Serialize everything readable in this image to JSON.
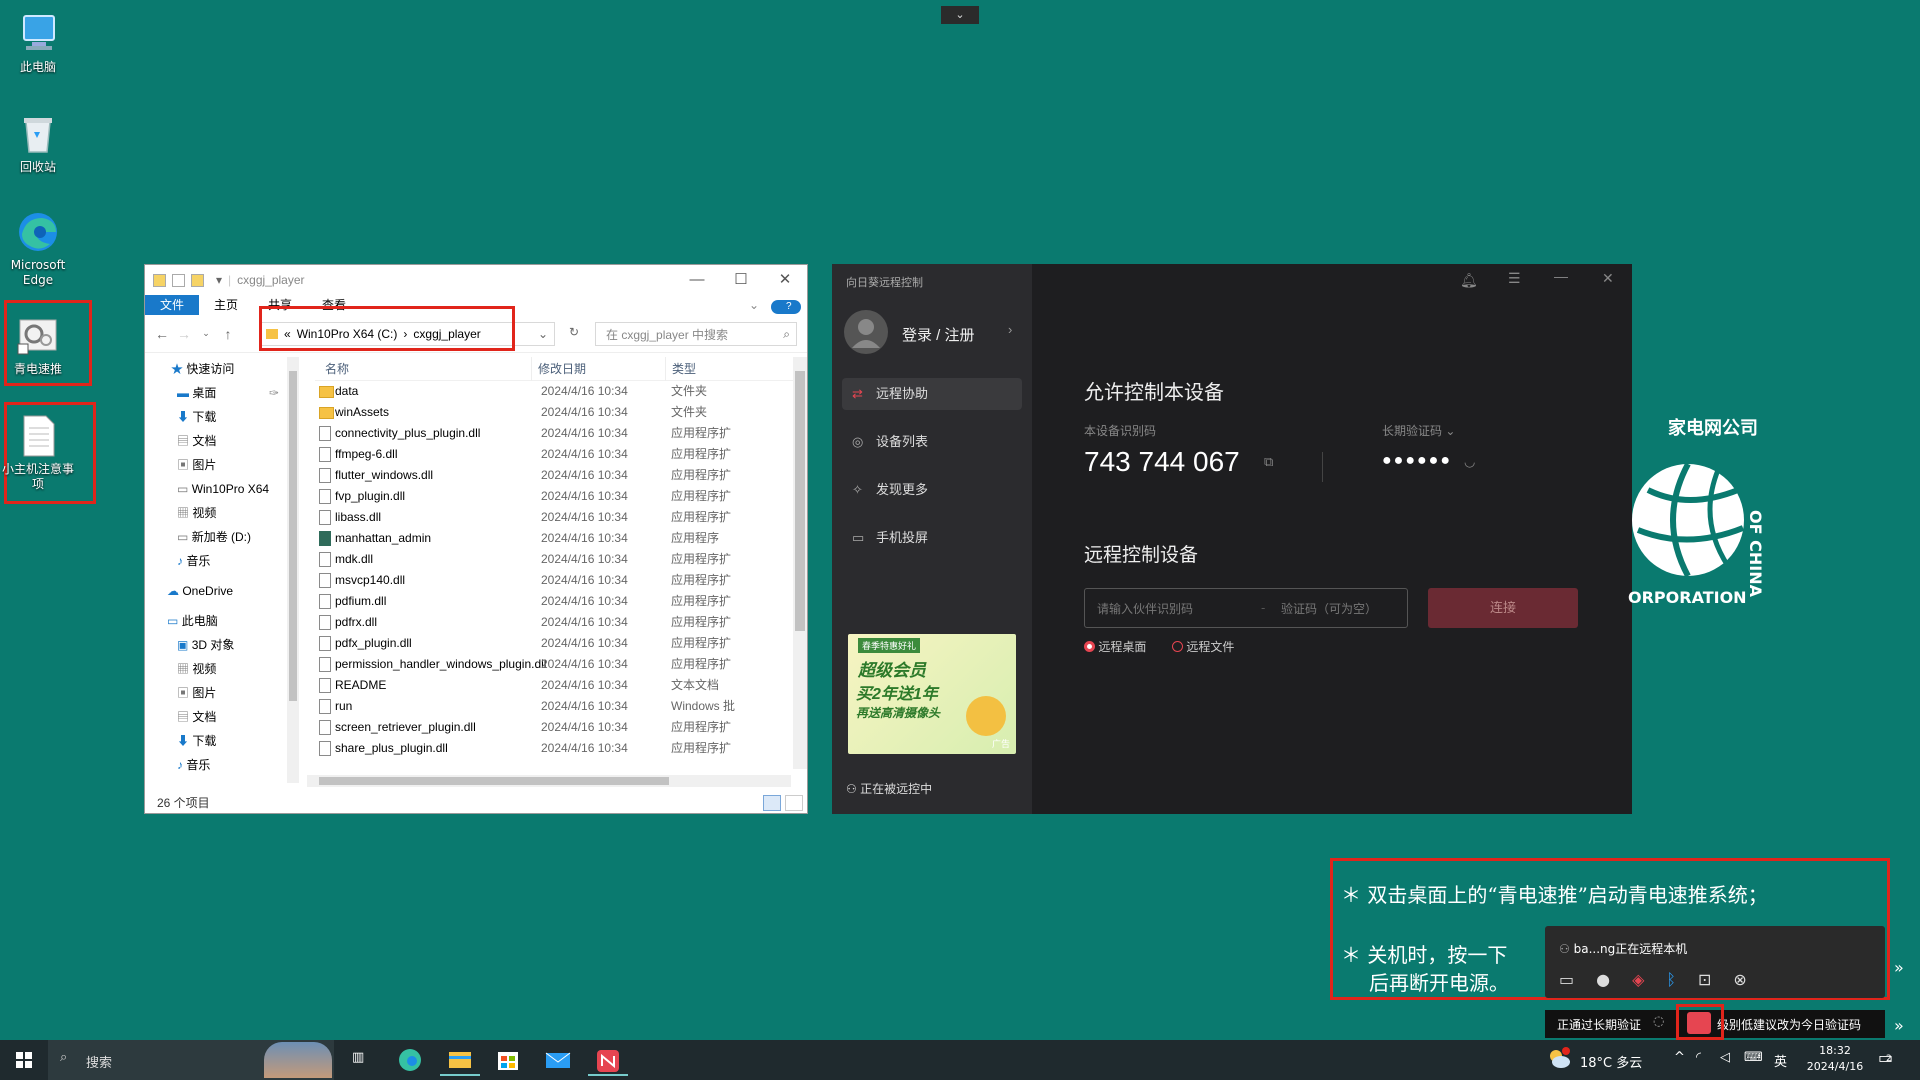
{
  "desktop": {
    "icons": [
      {
        "label": "此电脑",
        "icon": "computer-icon"
      },
      {
        "label": "回收站",
        "icon": "recycle-bin-icon"
      },
      {
        "label": "Microsoft Edge",
        "icon": "edge-icon"
      },
      {
        "label": "青电速推",
        "icon": "app-gear-icon"
      },
      {
        "label": "小主机注意事项",
        "icon": "text-file-icon"
      }
    ]
  },
  "explorer": {
    "title": "cxggj_player",
    "controls": {
      "min": "—",
      "max": "☐",
      "close": "✕"
    },
    "ribbon": [
      "文件",
      "主页",
      "共享",
      "查看"
    ],
    "address": {
      "prefix": "«",
      "segments": [
        "Win10Pro X64 (C:)",
        "cxggj_player"
      ],
      "sep": "›"
    },
    "search_placeholder": "在 cxggj_player 中搜索",
    "nav": [
      "快速访问",
      "桌面",
      "下载",
      "文档",
      "图片",
      "Win10Pro X64",
      "视频",
      "新加卷 (D:)",
      "音乐",
      "OneDrive",
      "此电脑",
      "3D 对象",
      "视频",
      "图片",
      "文档",
      "下载",
      "音乐"
    ],
    "columns": {
      "name": "名称",
      "date": "修改日期",
      "type": "类型"
    },
    "files": [
      {
        "name": "data",
        "date": "2024/4/16 10:34",
        "type": "文件夹",
        "kind": "folder"
      },
      {
        "name": "winAssets",
        "date": "2024/4/16 10:34",
        "type": "文件夹",
        "kind": "folder"
      },
      {
        "name": "connectivity_plus_plugin.dll",
        "date": "2024/4/16 10:34",
        "type": "应用程序扩",
        "kind": "file"
      },
      {
        "name": "ffmpeg-6.dll",
        "date": "2024/4/16 10:34",
        "type": "应用程序扩",
        "kind": "file"
      },
      {
        "name": "flutter_windows.dll",
        "date": "2024/4/16 10:34",
        "type": "应用程序扩",
        "kind": "file"
      },
      {
        "name": "fvp_plugin.dll",
        "date": "2024/4/16 10:34",
        "type": "应用程序扩",
        "kind": "file"
      },
      {
        "name": "libass.dll",
        "date": "2024/4/16 10:34",
        "type": "应用程序扩",
        "kind": "file"
      },
      {
        "name": "manhattan_admin",
        "date": "2024/4/16 10:34",
        "type": "应用程序",
        "kind": "app"
      },
      {
        "name": "mdk.dll",
        "date": "2024/4/16 10:34",
        "type": "应用程序扩",
        "kind": "file"
      },
      {
        "name": "msvcp140.dll",
        "date": "2024/4/16 10:34",
        "type": "应用程序扩",
        "kind": "file"
      },
      {
        "name": "pdfium.dll",
        "date": "2024/4/16 10:34",
        "type": "应用程序扩",
        "kind": "file"
      },
      {
        "name": "pdfrx.dll",
        "date": "2024/4/16 10:34",
        "type": "应用程序扩",
        "kind": "file"
      },
      {
        "name": "pdfx_plugin.dll",
        "date": "2024/4/16 10:34",
        "type": "应用程序扩",
        "kind": "file"
      },
      {
        "name": "permission_handler_windows_plugin.dll",
        "date": "2024/4/16 10:34",
        "type": "应用程序扩",
        "kind": "file"
      },
      {
        "name": "README",
        "date": "2024/4/16 10:34",
        "type": "文本文档",
        "kind": "file"
      },
      {
        "name": "run",
        "date": "2024/4/16 10:34",
        "type": "Windows 批",
        "kind": "file"
      },
      {
        "name": "screen_retriever_plugin.dll",
        "date": "2024/4/16 10:34",
        "type": "应用程序扩",
        "kind": "file"
      },
      {
        "name": "share_plus_plugin.dll",
        "date": "2024/4/16 10:34",
        "type": "应用程序扩",
        "kind": "file"
      }
    ],
    "status": "26 个项目"
  },
  "sunlogin": {
    "app_name": "向日葵远程控制",
    "login": "登录 / 注册",
    "menu": [
      "远程协助",
      "设备列表",
      "发现更多",
      "手机投屏"
    ],
    "allow_title": "允许控制本设备",
    "device_id_label": "本设备识别码",
    "device_id": "743 744 067",
    "code_label": "长期验证码",
    "code_value": "●●●●●●",
    "remote_title": "远程控制设备",
    "partner_placeholder": "请输入伙伴识别码",
    "verify_placeholder": "验证码（可为空）",
    "connect": "连接",
    "radio_desktop": "远程桌面",
    "radio_file": "远程文件",
    "ad": {
      "tag": "春季特惠好礼",
      "line1": "超级会员",
      "line2": "买2年送1年",
      "line3": "再送高清摄像头",
      "badge": "广告"
    },
    "being_controlled": "正在被远控中"
  },
  "logo_text": {
    "top": "家电网公司",
    "side": "OF CHINA",
    "bottom": "ORPORATION"
  },
  "notes": {
    "line1": "＊ 双击桌面上的“青电速推”启动青电速推系统；",
    "line2a": "＊ 关机时，按一下",
    "line2b": "后再断开电源。"
  },
  "remote_panel": {
    "user": "ba...ng正在远程本机",
    "status": "正通过长期验证",
    "status2": "级别低建议改为今日验证码"
  },
  "taskbar": {
    "search": "搜索",
    "weather": "18°C 多云",
    "ime": "英",
    "time": "18:32",
    "date": "2024/4/16",
    "notif_count": "2"
  },
  "colors": {
    "desktop": "#0a7a6f",
    "accent_red": "#e1251b",
    "explorer_blue": "#1979ca",
    "sun_red": "#e64551"
  }
}
